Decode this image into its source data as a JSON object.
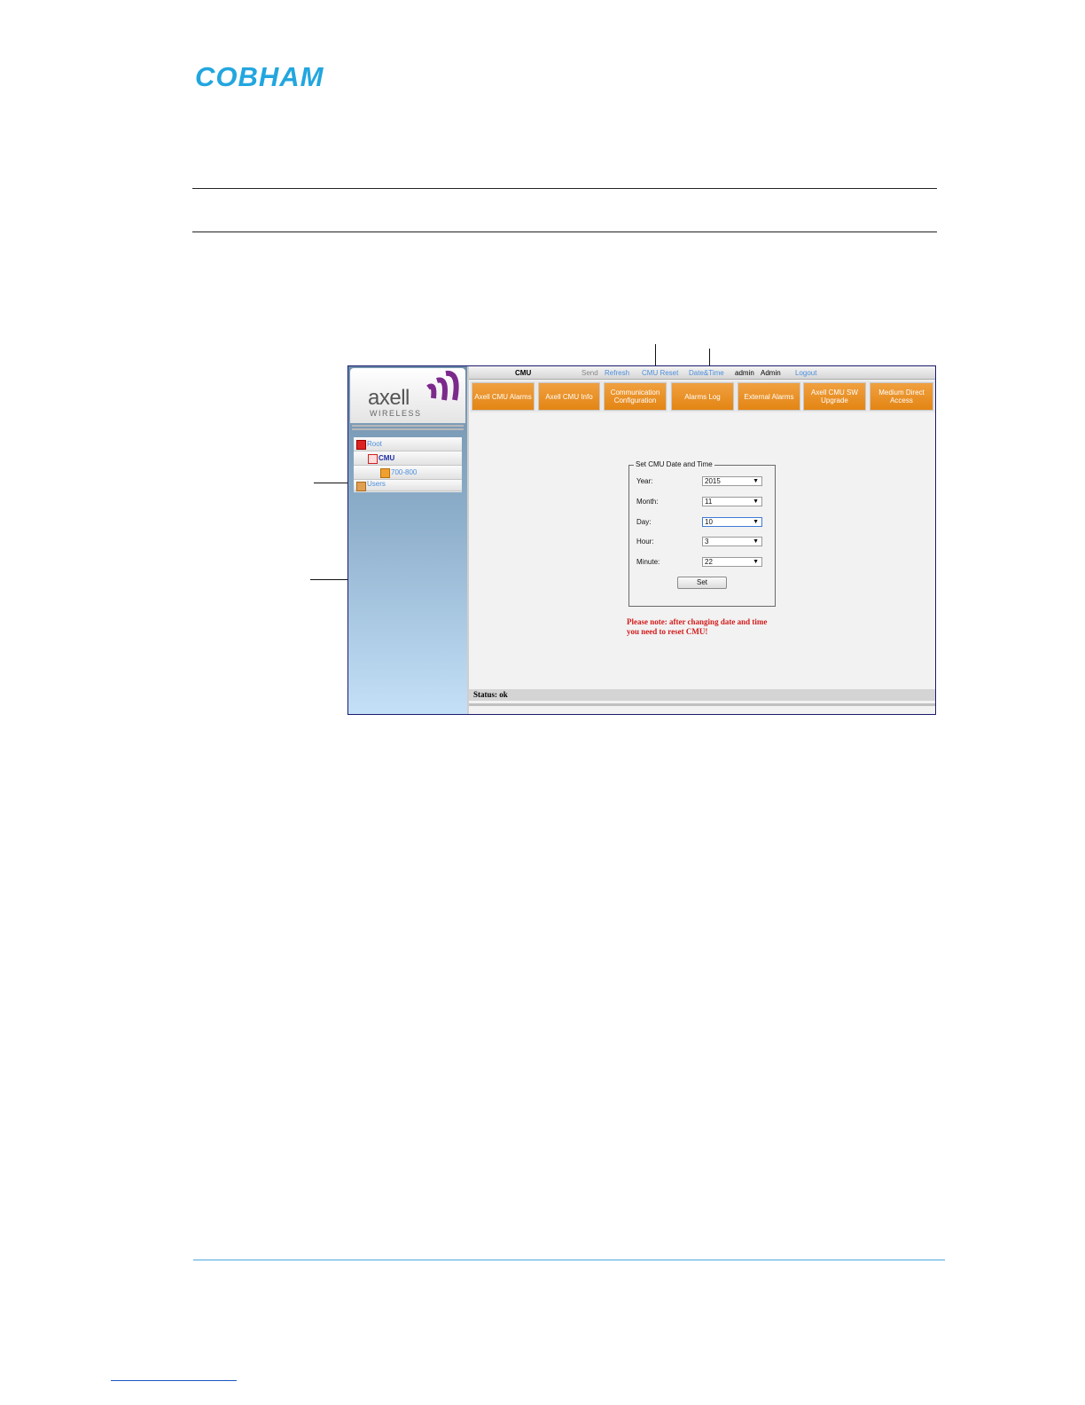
{
  "document": {
    "brand_logo_text": "COBHAM",
    "colors": {
      "brand": "#22a6df",
      "footer_rule": "#4aa8dc",
      "link": "#1a57c0"
    }
  },
  "app": {
    "logo": {
      "name": "axell",
      "sub": "WIRELESS"
    },
    "topbar": {
      "title": "CMU",
      "send": "Send",
      "refresh": "Refresh",
      "cmu_reset": "CMU Reset",
      "date_time": "Date&Time",
      "user": "admin",
      "role": "Admin",
      "logout": "Logout"
    },
    "tabs": [
      {
        "label": "Axell CMU Alarms"
      },
      {
        "label": "Axell CMU Info"
      },
      {
        "label": "Communication Configuration"
      },
      {
        "label": "Alarms Log"
      },
      {
        "label": "External Alarms"
      },
      {
        "label": "Axell CMU SW Upgrade"
      },
      {
        "label": "Medium Direct Access"
      }
    ],
    "tree": [
      {
        "label": "Root",
        "icon": "alarm-red-icon"
      },
      {
        "label": "CMU",
        "icon": "device-icon"
      },
      {
        "label": "700-800",
        "icon": "folder-icon"
      },
      {
        "label": "Users",
        "icon": "users-icon"
      }
    ],
    "form": {
      "legend": "Set CMU Date and Time",
      "year_label": "Year:",
      "year_value": "2015",
      "month_label": "Month:",
      "month_value": "11",
      "day_label": "Day:",
      "day_value": "10",
      "hour_label": "Hour:",
      "hour_value": "3",
      "minute_label": "Minute:",
      "minute_value": "22",
      "set_label": "Set"
    },
    "note": "Please note: after changing date and time you need to reset CMU!",
    "status": "Status: ok",
    "colors": {
      "tab": "#e38513",
      "note": "#d21b1b",
      "link": "#4d8fdc",
      "logo_accent": "#7b2a8c"
    }
  }
}
